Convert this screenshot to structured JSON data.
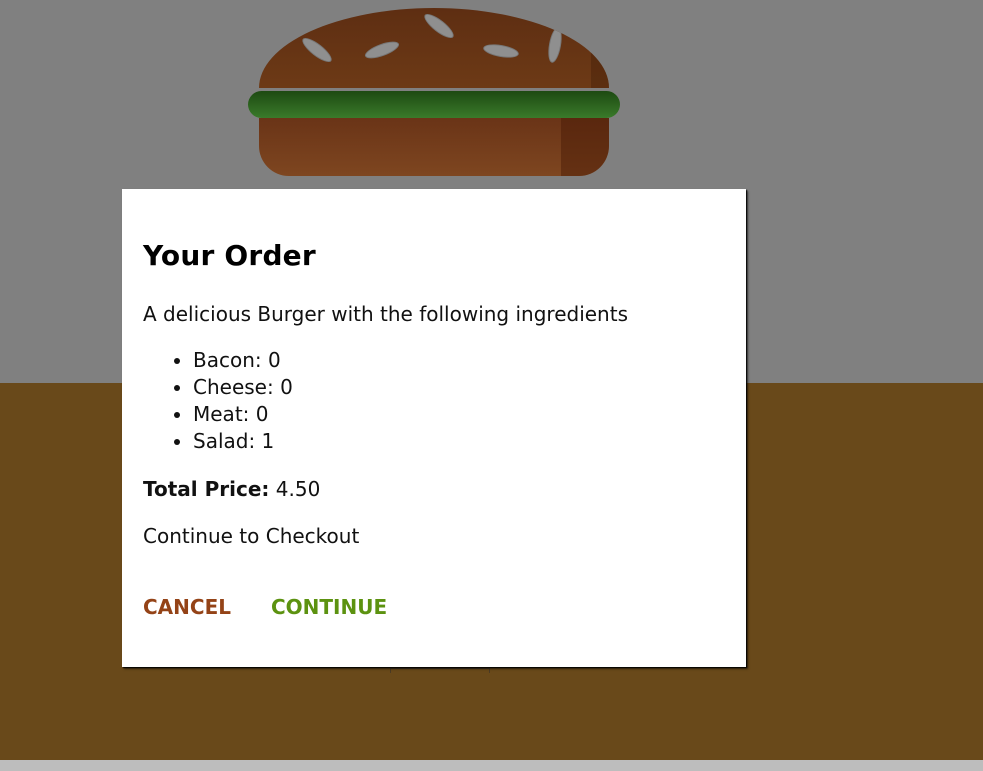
{
  "modal": {
    "title": "Your Order",
    "intro": "A delicious Burger with the following ingredients",
    "ingredients": [
      {
        "text": "Bacon: 0"
      },
      {
        "text": "Cheese: 0"
      },
      {
        "text": "Meat: 0"
      },
      {
        "text": "Salad: 1"
      }
    ],
    "total_label": "Total Price:",
    "total_value": "4.50",
    "checkout_prompt": "Continue to Checkout",
    "cancel_label": "CANCEL",
    "continue_label": "CONTINUE"
  },
  "colors": {
    "backdrop": "#808080",
    "controls_bg": "#69491a",
    "cancel": "#944317",
    "continue": "#5c9210"
  },
  "icons": [
    "burger-illustration"
  ]
}
